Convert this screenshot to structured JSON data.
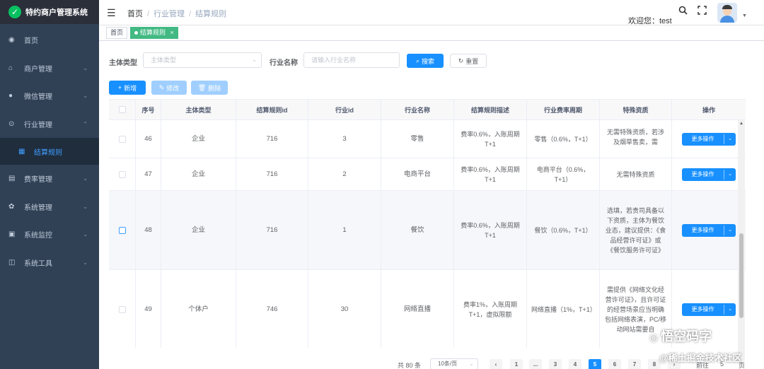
{
  "app": {
    "title": "特约商户管理系统",
    "logo_icon": "wechat-logo"
  },
  "sidebar": {
    "items": [
      {
        "label": "首页",
        "icon": "dashboard-icon",
        "glyph": "◉",
        "has_children": false
      },
      {
        "label": "商户管理",
        "icon": "shop-icon",
        "glyph": "⌂",
        "has_children": true
      },
      {
        "label": "微信管理",
        "icon": "chat-icon",
        "glyph": "●",
        "has_children": true
      },
      {
        "label": "行业管理",
        "icon": "industry-icon",
        "glyph": "⊙",
        "has_children": true,
        "expanded": true
      },
      {
        "label": "费率管理",
        "icon": "rate-icon",
        "glyph": "▤",
        "has_children": true
      },
      {
        "label": "系统管理",
        "icon": "settings-icon",
        "glyph": "✿",
        "has_children": true
      },
      {
        "label": "系统监控",
        "icon": "monitor-icon",
        "glyph": "▣",
        "has_children": true
      },
      {
        "label": "系统工具",
        "icon": "tools-icon",
        "glyph": "◫",
        "has_children": true
      }
    ],
    "subitem": {
      "label": "结算规则",
      "icon": "list-icon",
      "glyph": "▦"
    }
  },
  "header": {
    "breadcrumb": [
      "首页",
      "行业管理",
      "结算规则"
    ],
    "welcome": "欢迎您：test",
    "search_icon": "search-icon",
    "fullscreen_icon": "fullscreen-icon"
  },
  "tags": {
    "home": "首页",
    "active": "结算规则",
    "close": "×"
  },
  "filters": {
    "subject_label": "主体类型",
    "subject_placeholder": "主体类型",
    "industry_label": "行业名称",
    "industry_placeholder": "请输入行业名称",
    "search_label": "搜索",
    "reset_label": "重置"
  },
  "toolbar": {
    "add": "新增",
    "edit": "修改",
    "delete": "删除"
  },
  "table": {
    "columns": [
      "序号",
      "主体类型",
      "结算规则id",
      "行业id",
      "行业名称",
      "结算规则描述",
      "行业费率周期",
      "特殊资质",
      "操作"
    ],
    "op_label": "更多操作",
    "rows": [
      {
        "no": "46",
        "subject": "企业",
        "rule_id": "716",
        "industry_id": "3",
        "industry": "零售",
        "desc": "费率0.6%，入账周期T+1",
        "cycle": "零售（0.6%，T+1）",
        "qual": "无需特殊资质，若涉及烟草售卖，需"
      },
      {
        "no": "47",
        "subject": "企业",
        "rule_id": "716",
        "industry_id": "2",
        "industry": "电商平台",
        "desc": "费率0.6%，入账周期T+1",
        "cycle": "电商平台（0.6%，T+1）",
        "qual": "无需特殊资质"
      },
      {
        "no": "48",
        "subject": "企业",
        "rule_id": "716",
        "industry_id": "1",
        "industry": "餐饮",
        "desc": "费率0.6%，入账周期T+1",
        "cycle": "餐饮（0.6%，T+1）",
        "qual": "选填，若贵司具备以下资质，主体为餐饮业态，建议提供：《食品经营许可证》或《餐饮服务许可证》"
      },
      {
        "no": "49",
        "subject": "个体户",
        "rule_id": "746",
        "industry_id": "30",
        "industry": "网络直播",
        "desc": "费率1%，入账周期T+1，虚拟限额",
        "cycle": "网络直播（1%，T+1）",
        "qual": "需提供《网络文化经营许可证》，且许可证的经营场景应当明确包括网络表演，PC/移动网站需要自"
      }
    ]
  },
  "pagination": {
    "total": "共 80 条",
    "page_size": "10条/页",
    "prev": "‹",
    "pages": [
      "1",
      "...",
      "3",
      "4",
      "5",
      "6",
      "7",
      "8"
    ],
    "active_page": "5",
    "next": "›",
    "goto": "前往",
    "goto_value": "5",
    "page_unit": "页"
  },
  "watermarks": {
    "wm1": "悟空码字",
    "wm2": "@稀土掘金技术社区"
  }
}
